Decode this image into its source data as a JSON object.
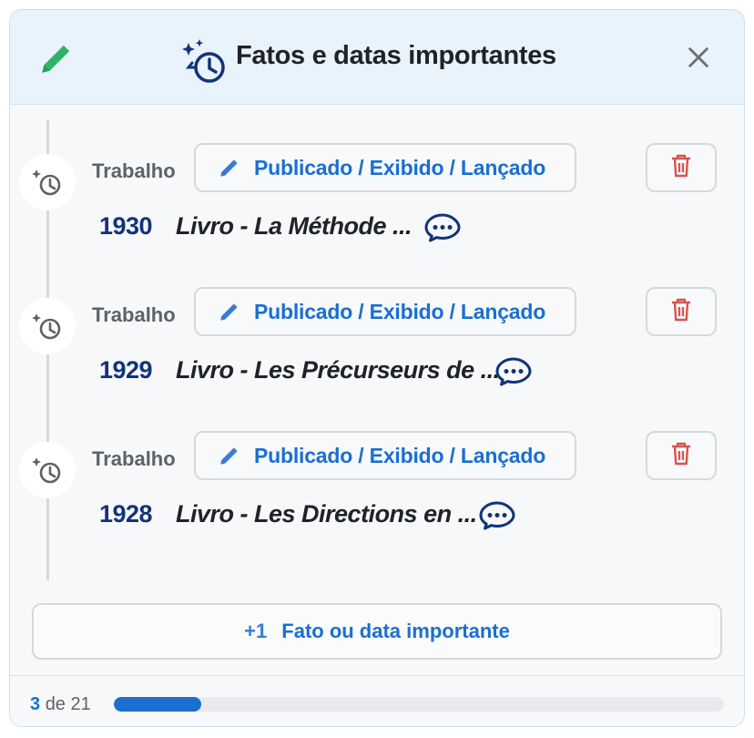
{
  "header": {
    "title": "Fatos e datas importantes",
    "icons": {
      "left": "pencil-icon",
      "title": "history-sparkle-icon",
      "close": "close-icon"
    }
  },
  "entries": [
    {
      "category": "Trabalho",
      "status": "Publicado / Exibido / Lançado",
      "year": "1930",
      "description": "Livro - La Méthode ..."
    },
    {
      "category": "Trabalho",
      "status": "Publicado / Exibido / Lançado",
      "year": "1929",
      "description": "Livro - Les Précurseurs de ..."
    },
    {
      "category": "Trabalho",
      "status": "Publicado / Exibido / Lançado",
      "year": "1928",
      "description": "Livro - Les Directions en ..."
    }
  ],
  "add_button": {
    "plus": "+1",
    "label": "Fato ou data importante"
  },
  "footer": {
    "current": "3",
    "separator": "de",
    "total": "21",
    "progress": 0.143
  },
  "colors": {
    "accent": "#1a6fcf",
    "year": "#12337a",
    "delete": "#d9534f",
    "pencil": "#2fb36a"
  }
}
